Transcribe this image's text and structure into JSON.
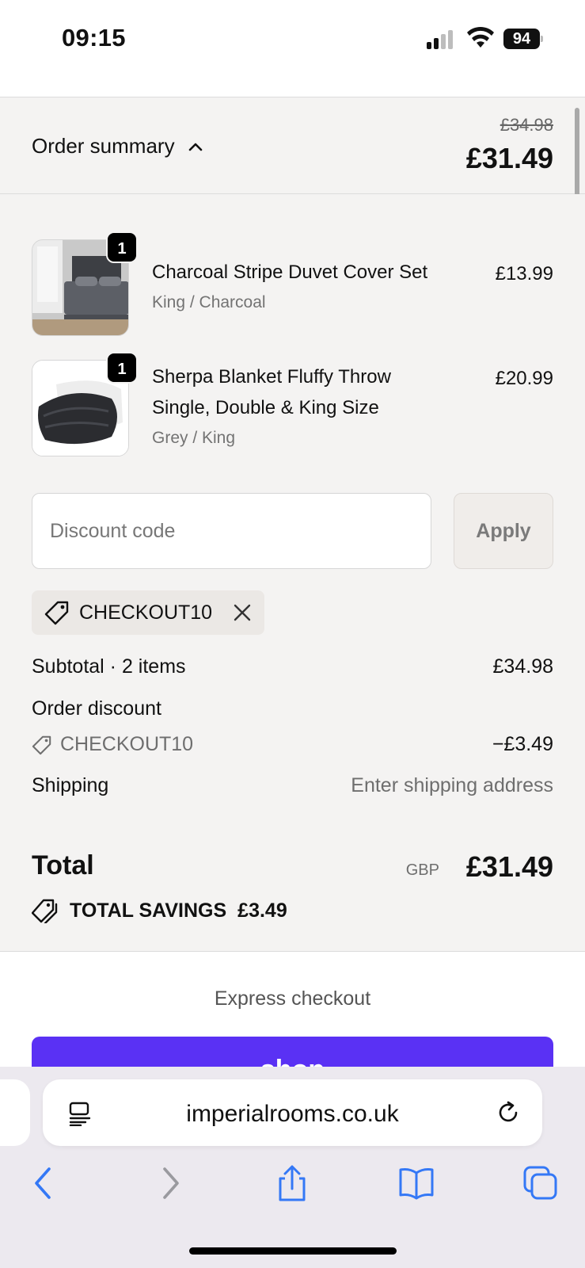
{
  "status_bar": {
    "time": "09:15",
    "battery": "94"
  },
  "summary": {
    "toggle_label": "Order summary",
    "original_total": "£34.98",
    "total": "£31.49"
  },
  "items": [
    {
      "quantity": "1",
      "name": "Charcoal Stripe Duvet Cover Set",
      "variant": "King / Charcoal",
      "price": "£13.99"
    },
    {
      "quantity": "1",
      "name_line1": "Sherpa Blanket Fluffy Throw",
      "name_line2": "Single, Double & King Size",
      "variant": "Grey / King",
      "price": "£20.99"
    }
  ],
  "discount": {
    "placeholder": "Discount code",
    "apply_label": "Apply",
    "applied_code": "CHECKOUT10"
  },
  "breakdown": {
    "subtotal_label": "Subtotal · 2 items",
    "subtotal_value": "£34.98",
    "order_discount_label": "Order discount",
    "discount_code": "CHECKOUT10",
    "discount_value": "−£3.49",
    "shipping_label": "Shipping",
    "shipping_value": "Enter shipping address",
    "total_label": "Total",
    "currency": "GBP",
    "total_value": "£31.49",
    "savings_label": "TOTAL SAVINGS",
    "savings_value": "£3.49"
  },
  "express": {
    "label": "Express checkout",
    "shop_pay_label": "shop"
  },
  "browser": {
    "url": "imperialrooms.co.uk"
  },
  "colors": {
    "shop_pay": "#5a31f4",
    "panel_bg": "#f4f3f2",
    "ios_blue": "#3478f6"
  }
}
